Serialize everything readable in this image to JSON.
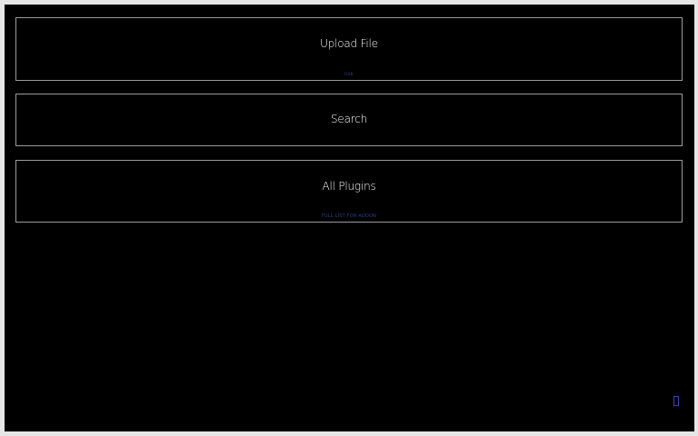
{
  "cards": [
    {
      "id": "upload",
      "title": "Upload File",
      "subtitle": "link"
    },
    {
      "id": "search",
      "title": "Search"
    },
    {
      "id": "plugins",
      "title": "All Plugins",
      "subtitle": "FULL LIST FOR ADDON"
    }
  ],
  "icons": {
    "corner": "menu-icon"
  },
  "colors": {
    "background": "#000000",
    "border": "#9a9a9a",
    "text": "#ffffff",
    "accent": "#2f47b8"
  }
}
